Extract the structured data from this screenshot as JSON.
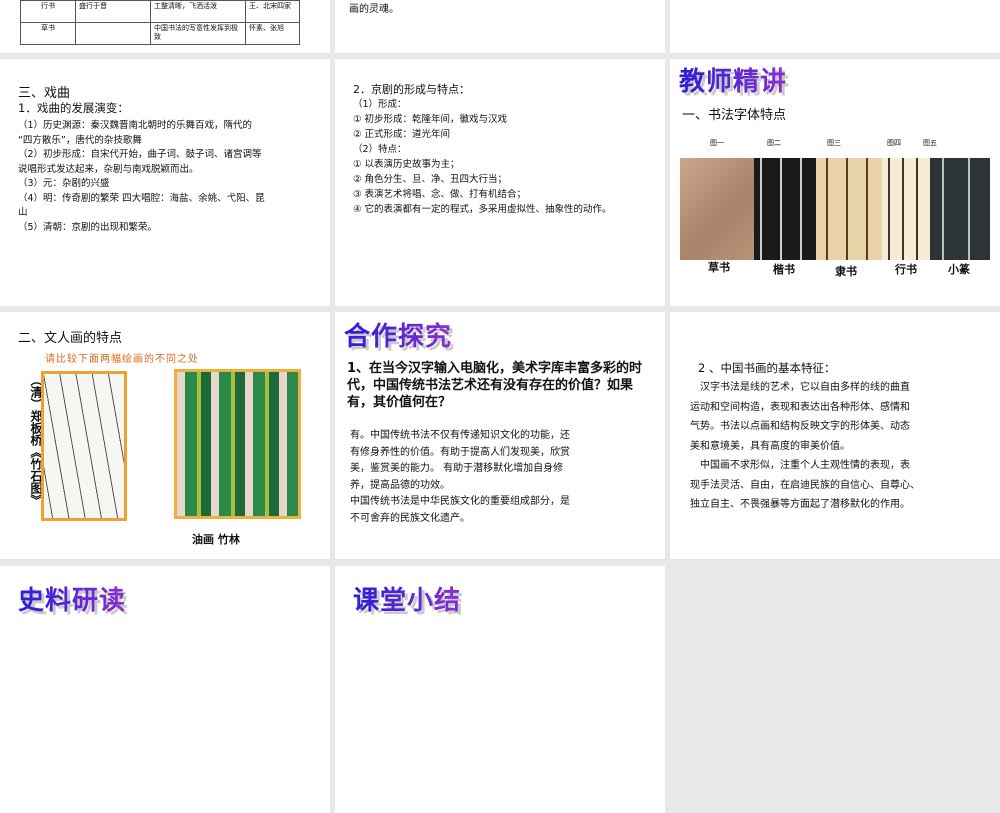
{
  "slide_table": {
    "rows": [
      [
        "行书",
        "盛行于晋",
        "工整清晰，飞洒活泼",
        "王、北宋四家"
      ],
      [
        "草书",
        "",
        "中国书法的写意性发挥到极致",
        "怀素、张旭"
      ]
    ]
  },
  "slide_soul": {
    "text": "画的灵魂。"
  },
  "slide_opera": {
    "heading": "三、戏曲",
    "sub": "1．戏曲的发展演变：",
    "lines": [
      "（1）历史渊源：秦汉魏晋南北朝时的乐舞百戏，隋代的",
      "“四方散乐”，唐代的杂技歌舞",
      "（2）初步形成：自宋代开始，曲子词、鼓子词、诸宫调等",
      "说唱形式发达起来，杂剧与南戏脱颖而出。",
      "（3）元：杂剧的兴盛",
      "（4）明：传奇剧的繁荣 四大唱腔：海盐、余姚、弋阳、昆",
      "山",
      "（5）清朝：京剧的出现和繁荣。"
    ]
  },
  "slide_peking": {
    "heading": "2．京剧的形成与特点：",
    "lines": [
      "（1）形成：",
      "① 初步形成：乾隆年间，徽戏与汉戏",
      "② 正式形成：道光年间",
      "（2）特点：",
      "① 以表演历史故事为主；",
      "② 角色分生、旦、净、丑四大行当；",
      "③ 表演艺术将唱、念、做、打有机结合；",
      "④ 它的表演都有一定的程式，多采用虚拟性、抽象性的动作。"
    ]
  },
  "slide_teacher": {
    "title": "教师精讲",
    "sub": "一、书法字体特点",
    "figs": [
      "图一",
      "图二",
      "图三",
      "图四",
      "图五"
    ],
    "labels": [
      "草书",
      "楷书",
      "隶书",
      "行书",
      "小篆"
    ]
  },
  "slide_painting": {
    "heading": "二、文人画的特点",
    "prompt": "请比较下面两幅绘画的不同之处",
    "left_caption": "（清）郑板桥《竹石图》",
    "right_caption": "油画 竹林"
  },
  "slide_coop": {
    "title": "合作探究",
    "question": "1、在当今汉字输入电脑化，美术字库丰富多彩的时代，中国传统书法艺术还有没有存在的价值？如果有，其价值何在？",
    "answer": [
      "有。中国传统书法不仅有传递知识文化的功能，还",
      "有修身养性的价值。有助于提高人们发现美，欣赏",
      "美，鉴赏美的能力。 有助于潜移默化增加自身修",
      "养，提高品德的功效。",
      "中国传统书法是中华民族文化的重要组成部分，是",
      "不可舍弃的民族文化遗产。"
    ]
  },
  "slide_features": {
    "heading": "2 、中国书画的基本特征：",
    "lines": [
      "汉字书法是线的艺术，它以自由多样的线的曲直",
      "运动和空间构造，表现和表达出各种形体、感情和",
      "气势。书法以点画和结构反映文字的形体美、动态",
      "美和意境美，具有高度的审美价值。",
      "中国画不求形似，注重个人主观性情的表现，表",
      "现手法灵活、自由，在启迪民族的自信心、自尊心、",
      "独立自主、不畏强暴等方面起了潜移默化的作用。"
    ]
  },
  "slide_history": {
    "title": "史料研读"
  },
  "slide_summary": {
    "title": "课堂小结"
  }
}
